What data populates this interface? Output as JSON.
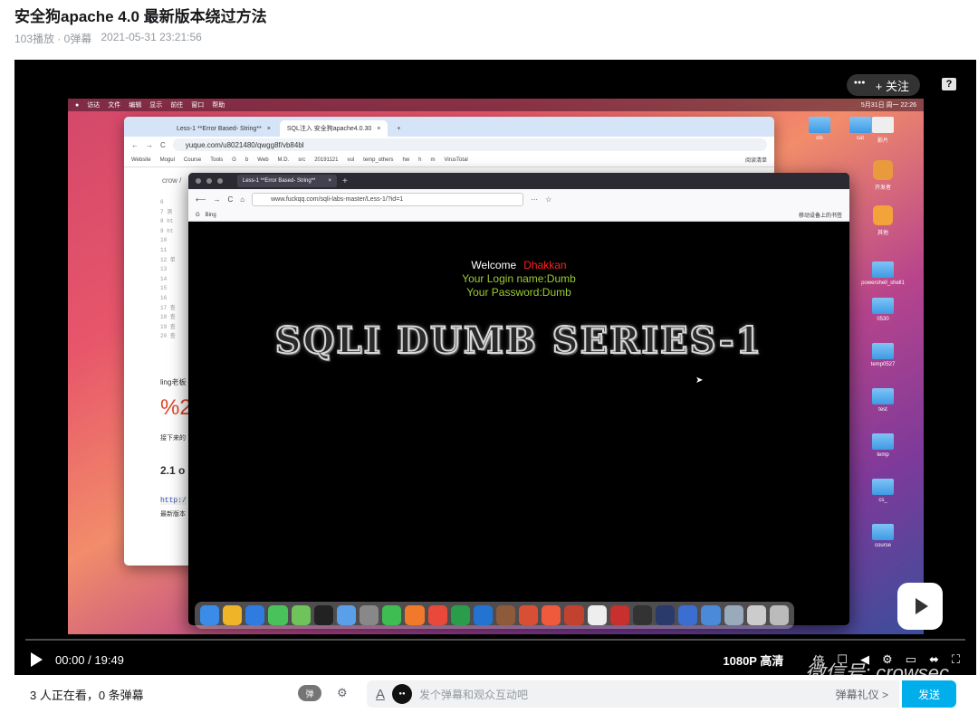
{
  "title": "安全狗apache 4.0 最新版本绕过方法",
  "meta": {
    "plays": "103播放 · 0弹幕",
    "date": "2021-05-31 23:21:56"
  },
  "player": {
    "follow": "+ 关注",
    "help": "?",
    "time": "00:00 / 19:49",
    "quality": "1080P 高清",
    "speed": "倍",
    "watermark": "微信号: crowsec"
  },
  "screen": {
    "menubar": {
      "items": [
        "访达",
        "文件",
        "编辑",
        "显示",
        "前往",
        "窗口",
        "帮助"
      ],
      "clock": "5月31日 周一 22:26"
    },
    "desktop": [
      "ols",
      "cat",
      "影片",
      "开发者",
      "其他",
      "powershell_shell1",
      "0530",
      "temp0527",
      "test",
      "hell",
      "temp",
      "cs_",
      "429",
      "course"
    ],
    "win1": {
      "tabs": [
        "Less-1 **Error Based- String**",
        "SQL注入 安全狗apache4.0.30"
      ],
      "url": "yuque.com/u8021480/qwgg8f/vb84bl",
      "bookmarks": [
        "Website",
        "Mogul",
        "Course",
        "Tools",
        "G",
        "b",
        "Web",
        "M.D.",
        "src",
        "20191121",
        "vul",
        "temp_others",
        "hw",
        "h",
        "m",
        "VirusTotal",
        "阅读清单"
      ],
      "crumb": "crow /",
      "lines": [
        "6",
        "7 测",
        "8 ht",
        "9 ht",
        "10",
        "11",
        "12 单",
        "13",
        "14",
        "15",
        "16",
        "17 查",
        "18 查",
        "19 查",
        "20 查"
      ],
      "text1": "ling老板",
      "big": "%2",
      "text2": "接下来的",
      "heading": "2.1 o",
      "code": "http:/",
      "text3": "最新版本"
    },
    "win2": {
      "tab": "Less-1 **Error Based- String**",
      "url": "www.fuckqq.com/sqli-labs-master/Less-1/?id=1",
      "bookmarks": [
        "G",
        "Bing"
      ],
      "mobile_bm": "移动设备上的书签",
      "welcome": "Welcome",
      "name": "Dhakkan",
      "login": "Your Login name:Dumb",
      "password": "Your Password:Dumb",
      "banner": "SQLI DUMB SERIES-1"
    }
  },
  "bottom": {
    "viewers": "3 人正在看，0 条弹幕",
    "toggle": "弹",
    "placeholder": "发个弹幕和观众互动吧",
    "gift": "弹幕礼仪 >",
    "send": "发送"
  }
}
